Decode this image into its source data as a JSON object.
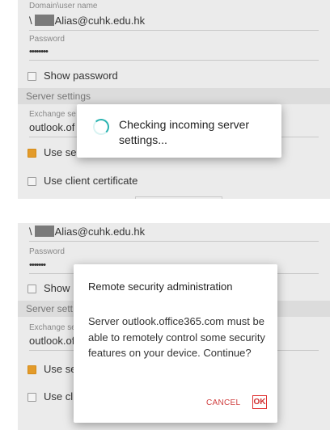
{
  "screen1": {
    "domain_label": "Domain\\user name",
    "domain_prefix": "\\",
    "domain_value": "Alias@cuhk.edu.hk",
    "password_label": "Password",
    "password_value": "••••••••",
    "show_password_label": "Show password",
    "server_settings_title": "Server settings",
    "exchange_label": "Exchange se",
    "exchange_value": "outlook.of",
    "use_ssl_label": "Use se",
    "use_client_cert_label": "Use client certificate",
    "progress_dialog": {
      "message": "Checking incoming server settings..."
    }
  },
  "screen2": {
    "domain_prefix": "\\",
    "domain_value": "Alias@cuhk.edu.hk",
    "password_label": "Password",
    "password_value": "•••••••",
    "show_password_label": "Show",
    "server_settings_title": "Server sett",
    "exchange_label": "Exchange se",
    "exchange_value": "outlook.of",
    "use_ssl_label": "Use se",
    "use_client_cert_label": "Use cli",
    "confirm_dialog": {
      "title": "Remote security administration",
      "body": "Server outlook.office365.com must be able to remotely control some security features on your device. Continue?",
      "cancel_label": "CANCEL",
      "ok_label": "OK"
    }
  },
  "colors": {
    "accent_teal": "#2ab3b0",
    "checkbox_orange": "#e39b2a",
    "button_red": "#d03030"
  }
}
